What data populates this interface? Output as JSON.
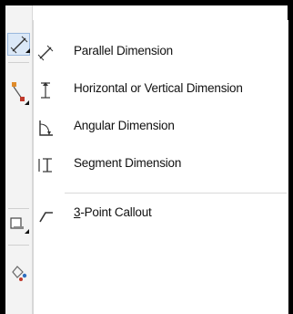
{
  "menu": {
    "items": [
      {
        "label": "Parallel Dimension",
        "icon": "parallel-dimension-icon"
      },
      {
        "label": "Horizontal or Vertical Dimension",
        "icon": "horizontal-vertical-dimension-icon"
      },
      {
        "label": "Angular Dimension",
        "icon": "angular-dimension-icon"
      },
      {
        "label": "Segment Dimension",
        "icon": "segment-dimension-icon"
      },
      {
        "label_mnemonic": "3",
        "label_rest": "-Point Callout",
        "icon": "three-point-callout-icon"
      }
    ]
  },
  "toolbar": {
    "buttons": [
      {
        "icon": "parallel-dimension-icon",
        "state": "active"
      },
      {
        "icon": "connector-icon"
      },
      {
        "icon": "shadow-icon"
      },
      {
        "icon": "fill-icon"
      }
    ]
  },
  "colors": {
    "frame": "#000000",
    "accent_red": "#c0392b",
    "accent_blue": "#2e6fbf",
    "active_bg": "#dbe8f7"
  }
}
